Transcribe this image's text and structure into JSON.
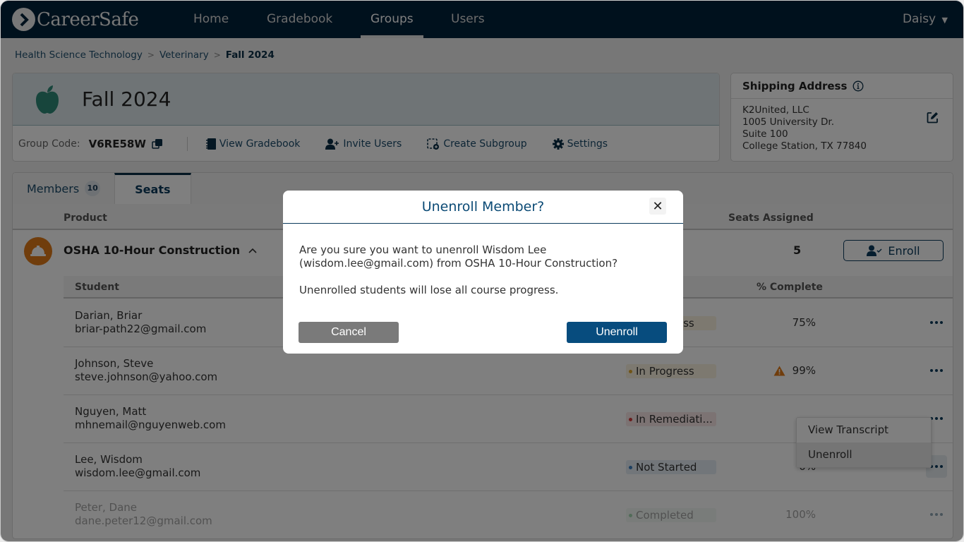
{
  "nav": {
    "brand": "CareerSafe",
    "items": [
      {
        "label": "Home",
        "active": false
      },
      {
        "label": "Gradebook",
        "active": false
      },
      {
        "label": "Groups",
        "active": true
      },
      {
        "label": "Users",
        "active": false
      }
    ],
    "user": "Daisy"
  },
  "breadcrumb": [
    "Health Science Technology",
    "Veterinary",
    "Fall 2024"
  ],
  "group": {
    "title": "Fall 2024",
    "icon": "apple-icon",
    "code_label": "Group Code:",
    "code": "V6RE58W",
    "actions": [
      {
        "label": "View Gradebook",
        "icon": "gradebook-icon"
      },
      {
        "label": "Invite Users",
        "icon": "user-plus-icon"
      },
      {
        "label": "Create Subgroup",
        "icon": "subgroup-icon"
      },
      {
        "label": "Settings",
        "icon": "gear-icon"
      }
    ]
  },
  "shipping": {
    "title": "Shipping Address",
    "lines": [
      "K2United, LLC",
      "1005 University Dr.",
      "Suite 100",
      "College Station, TX 77840"
    ]
  },
  "tabs": [
    {
      "label": "Members",
      "count": "10",
      "active": false
    },
    {
      "label": "Seats",
      "active": true
    }
  ],
  "seats": {
    "columns": {
      "product": "Product",
      "seats_assigned": "Seats Assigned"
    },
    "product": {
      "name": "OSHA 10-Hour Construction",
      "icon": "hard-hat-icon",
      "seats_assigned": "5",
      "enroll_label": "Enroll"
    },
    "student_columns": {
      "student": "Student",
      "percent": "% Complete"
    },
    "students": [
      {
        "name": "Darian, Briar",
        "email": "briar-path22@gmail.com",
        "status": "In Progress",
        "percent": "75%",
        "warning": false
      },
      {
        "name": "Johnson, Steve",
        "email": "steve.johnson@yahoo.com",
        "status": "In Progress",
        "percent": "99%",
        "warning": true
      },
      {
        "name": "Nguyen, Matt",
        "email": "mhnemail@nguyenweb.com",
        "status": "In Remediati...",
        "percent": "",
        "warning": false
      },
      {
        "name": "Lee, Wisdom",
        "email": "wisdom.lee@gmail.com",
        "status": "Not Started",
        "percent": "0%",
        "warning": false
      },
      {
        "name": "Peter, Dane",
        "email": "dane.peter12@gmail.com",
        "status": "Completed",
        "percent": "100%",
        "warning": false
      }
    ],
    "status_colors": {
      "In Progress": {
        "dot": "#e0a82e",
        "bg": "#fbf3e0"
      },
      "In Remediati...": {
        "dot": "#d43b3b",
        "bg": "#f8e6e6"
      },
      "Not Started": {
        "dot": "#3a7fc1",
        "bg": "#e5edf5"
      },
      "Completed": {
        "dot": "#3aa859",
        "bg": "#e4f3e7"
      }
    }
  },
  "context_menu": {
    "items": [
      "View Transcript",
      "Unenroll"
    ]
  },
  "modal": {
    "title": "Unenroll Member?",
    "message": "Are you sure you want to unenroll Wisdom Lee (wisdom.lee@gmail.com) from OSHA 10-Hour Construction?",
    "warning": "Unenrolled students will lose all course progress.",
    "cancel_label": "Cancel",
    "confirm_label": "Unenroll"
  }
}
